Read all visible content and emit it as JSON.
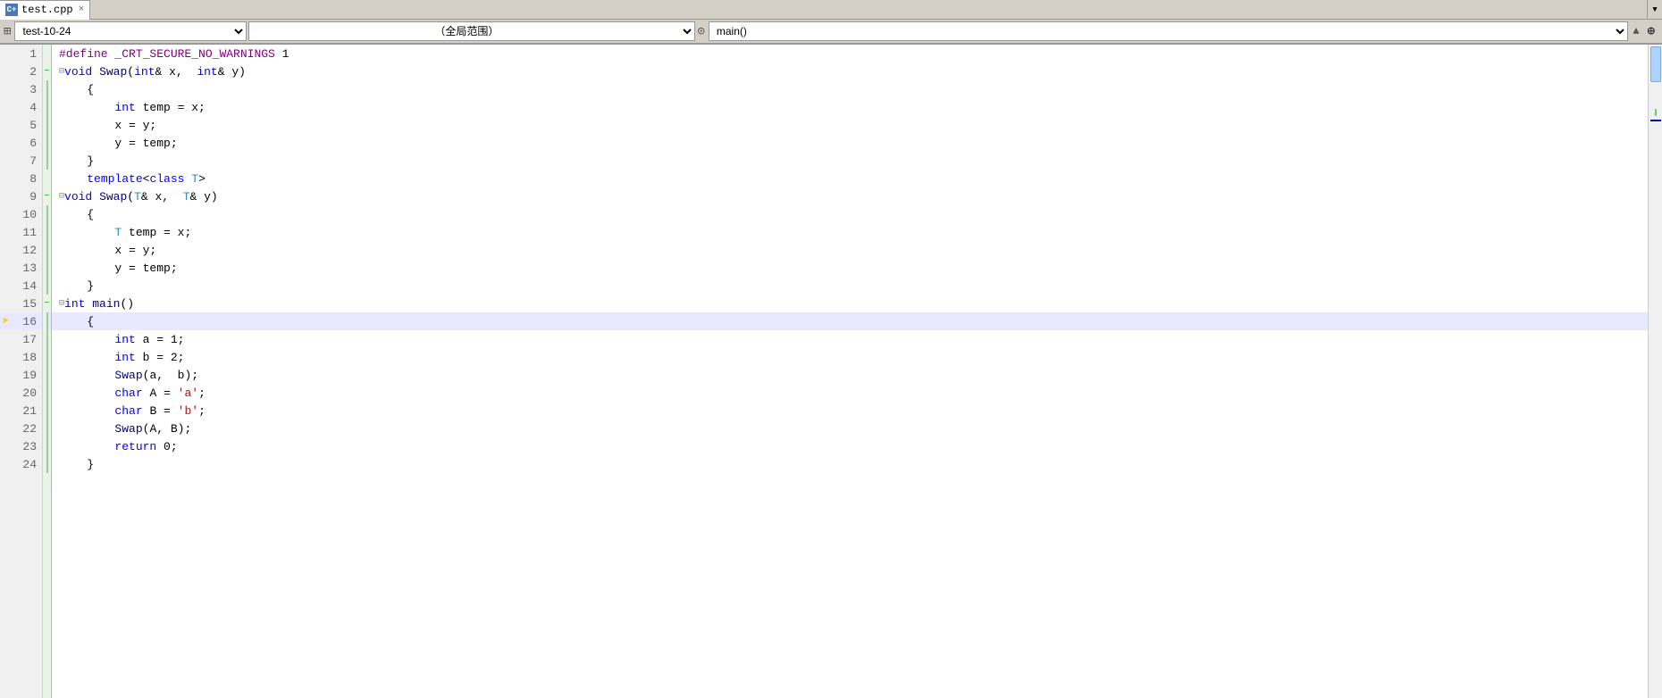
{
  "tab": {
    "label": "test.cpp",
    "icon": "C+",
    "close": "×"
  },
  "toolbar": {
    "file_selector": "test-10-24",
    "scope_selector": "（全局范围）",
    "func_selector": "main()",
    "func_icon": "⊙",
    "dropdown_arrow": "▾",
    "add_btn": "⊕"
  },
  "lines": [
    {
      "num": 1,
      "content": "#define _CRT_SECURE_NO_WARNINGS 1",
      "type": "define"
    },
    {
      "num": 2,
      "content": "void Swap(int& x,  int& y)",
      "type": "func_decl_collapse"
    },
    {
      "num": 3,
      "content": "{",
      "type": "brace"
    },
    {
      "num": 4,
      "content": "    int temp = x;",
      "type": "code"
    },
    {
      "num": 5,
      "content": "    x = y;",
      "type": "code"
    },
    {
      "num": 6,
      "content": "    y = temp;",
      "type": "code"
    },
    {
      "num": 7,
      "content": "}",
      "type": "brace"
    },
    {
      "num": 8,
      "content": "    template<class T>",
      "type": "template"
    },
    {
      "num": 9,
      "content": "void Swap(T& x,  T& y)",
      "type": "func_decl_collapse"
    },
    {
      "num": 10,
      "content": "{",
      "type": "brace"
    },
    {
      "num": 11,
      "content": "    T temp = x;",
      "type": "code"
    },
    {
      "num": 12,
      "content": "    x = y;",
      "type": "code"
    },
    {
      "num": 13,
      "content": "    y = temp;",
      "type": "code"
    },
    {
      "num": 14,
      "content": "}",
      "type": "brace"
    },
    {
      "num": 15,
      "content": "int main()",
      "type": "main_decl_collapse"
    },
    {
      "num": 16,
      "content": "{",
      "type": "brace_current"
    },
    {
      "num": 17,
      "content": "    int a = 1;",
      "type": "code"
    },
    {
      "num": 18,
      "content": "    int b = 2;",
      "type": "code"
    },
    {
      "num": 19,
      "content": "    Swap(a,  b);",
      "type": "code"
    },
    {
      "num": 20,
      "content": "    char A = 'a';",
      "type": "code"
    },
    {
      "num": 21,
      "content": "    char B = 'b';",
      "type": "code"
    },
    {
      "num": 22,
      "content": "    Swap(A, B);",
      "type": "code"
    },
    {
      "num": 23,
      "content": "    return 0;",
      "type": "code"
    },
    {
      "num": 24,
      "content": "}",
      "type": "brace"
    }
  ]
}
